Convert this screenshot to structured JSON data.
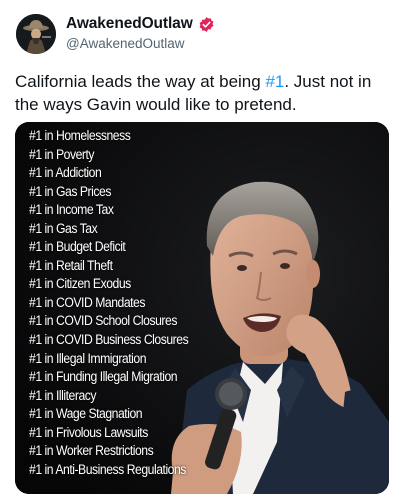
{
  "user": {
    "display_name": "AwakenedOutlaw",
    "handle": "@AwakenedOutlaw",
    "avatar_icon": "cowboy-avatar-icon",
    "verified_icon": "verified-badge-icon",
    "verified_color": "#e0245e"
  },
  "tweet": {
    "text_before": "California leads the way at being ",
    "hashtag": "#1",
    "text_after": ". Just not in the ways Gavin would like to pretend.",
    "hashtag_color": "#1d9bf0"
  },
  "media": {
    "list_items": [
      "#1 in Homelessness",
      "#1 in Poverty",
      "#1 in Addiction",
      "#1 in Gas Prices",
      "#1 in Income Tax",
      "#1 in Gas Tax",
      "#1 in Budget Deficit",
      "#1 in Retail Theft",
      "#1 in Citizen Exodus",
      "#1 in COVID Mandates",
      "#1 in COVID School Closures",
      "#1 in COVID Business Closures",
      "#1 in Illegal Immigration",
      "#1 in Funding Illegal Migration",
      "#1 in Illiteracy",
      "#1 in Wage Stagnation",
      "#1 in Frivolous Lawsuits",
      "#1 in Worker Restrictions",
      "#1 in Anti-Business Regulations"
    ]
  }
}
